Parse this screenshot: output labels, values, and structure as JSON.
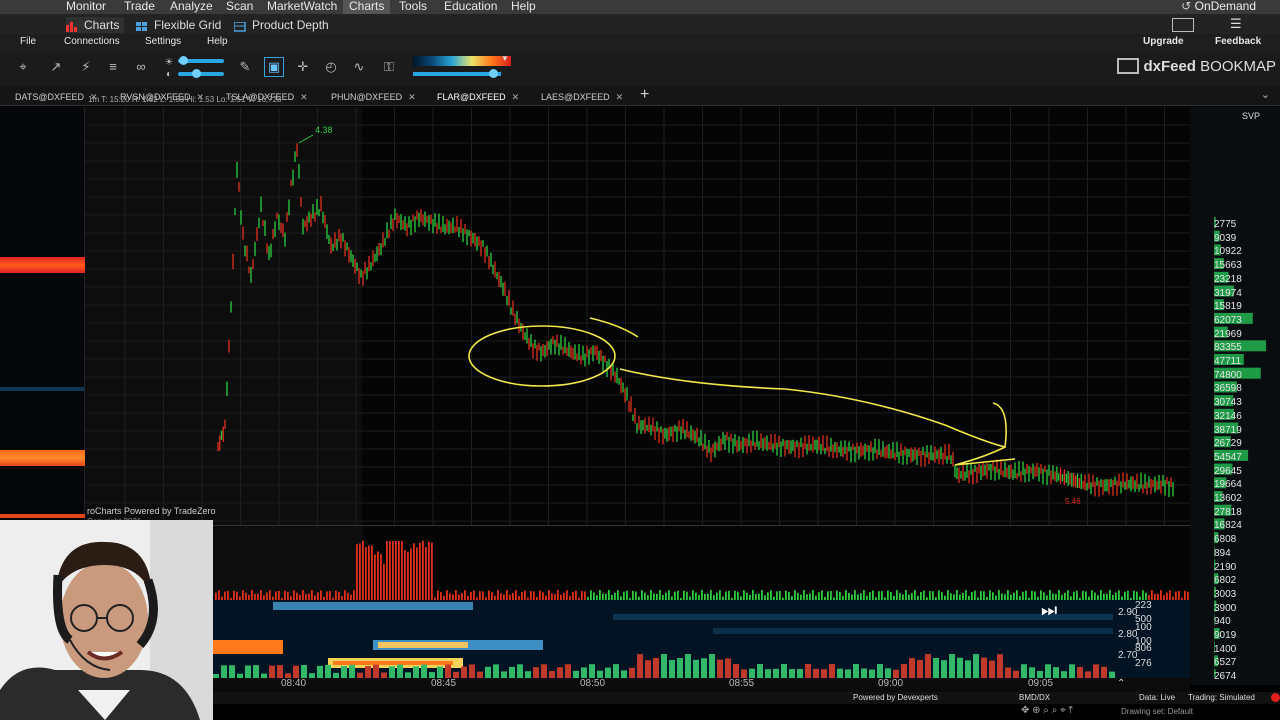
{
  "top_menu": {
    "items": [
      "Monitor",
      "Trade",
      "Analyze",
      "Scan",
      "MarketWatch",
      "Charts",
      "Tools",
      "Education",
      "Help"
    ],
    "active": "Charts",
    "ondemand": "OnDemand"
  },
  "sub_menu": {
    "charts": "Charts",
    "flexible_grid": "Flexible Grid",
    "product_depth": "Product Depth"
  },
  "bookmap_menu": {
    "file": "File",
    "connections": "Connections",
    "settings": "Settings",
    "help": "Help",
    "upgrade": "Upgrade",
    "feedback": "Feedback"
  },
  "brand": {
    "prefix": "dxFeed",
    "name": "BOOKMAP"
  },
  "symbol_tabs": [
    "DATS@DXFEED",
    "RVSN@DXFEED",
    "TSLA@DXFEED",
    "PHUN@DXFEED",
    "FLAR@DXFEED",
    "LAES@DXFEED"
  ],
  "svp": {
    "title": "SVP",
    "values": [
      "2775",
      "9039",
      "10922",
      "15663",
      "23218",
      "31974",
      "15819",
      "62073",
      "21969",
      "83355",
      "47711",
      "74800",
      "36598",
      "30743",
      "32146",
      "38719",
      "26729",
      "54547",
      "29645",
      "19664",
      "13602",
      "27818",
      "16824",
      "6808",
      "894",
      "2190",
      "6802",
      "3003",
      "3900",
      "940",
      "9019",
      "1400",
      "6527",
      "2674"
    ]
  },
  "chart_overlay": {
    "info": "1m  T: 15:20  H: 1.62  L: 1.53  Hi: 1.53  Lo: 1.51  V: 16,723",
    "watermark": "roCharts Powered by TradeZero",
    "copyright": "Copyright 2021",
    "high_marker": "4.38",
    "low_marker": "5.46"
  },
  "heatmap_prices": [
    "223",
    "2.90",
    "500",
    "100",
    "2.80",
    "100",
    "806",
    "2.70",
    "276"
  ],
  "time_labels": [
    "08:40",
    "08:45",
    "08:50",
    "08:55",
    "09:00",
    "09:05"
  ],
  "status": {
    "powered": "Powered by Devexperts",
    "feed": "BMD/DX",
    "data": "Data: Live",
    "trading": "Trading: Simulated",
    "drawing": "Drawing set: Default"
  },
  "colors": {
    "accent": "#29a7e0",
    "up": "#2ecc40",
    "down": "#e0301e",
    "annotation": "#f2e84a"
  }
}
